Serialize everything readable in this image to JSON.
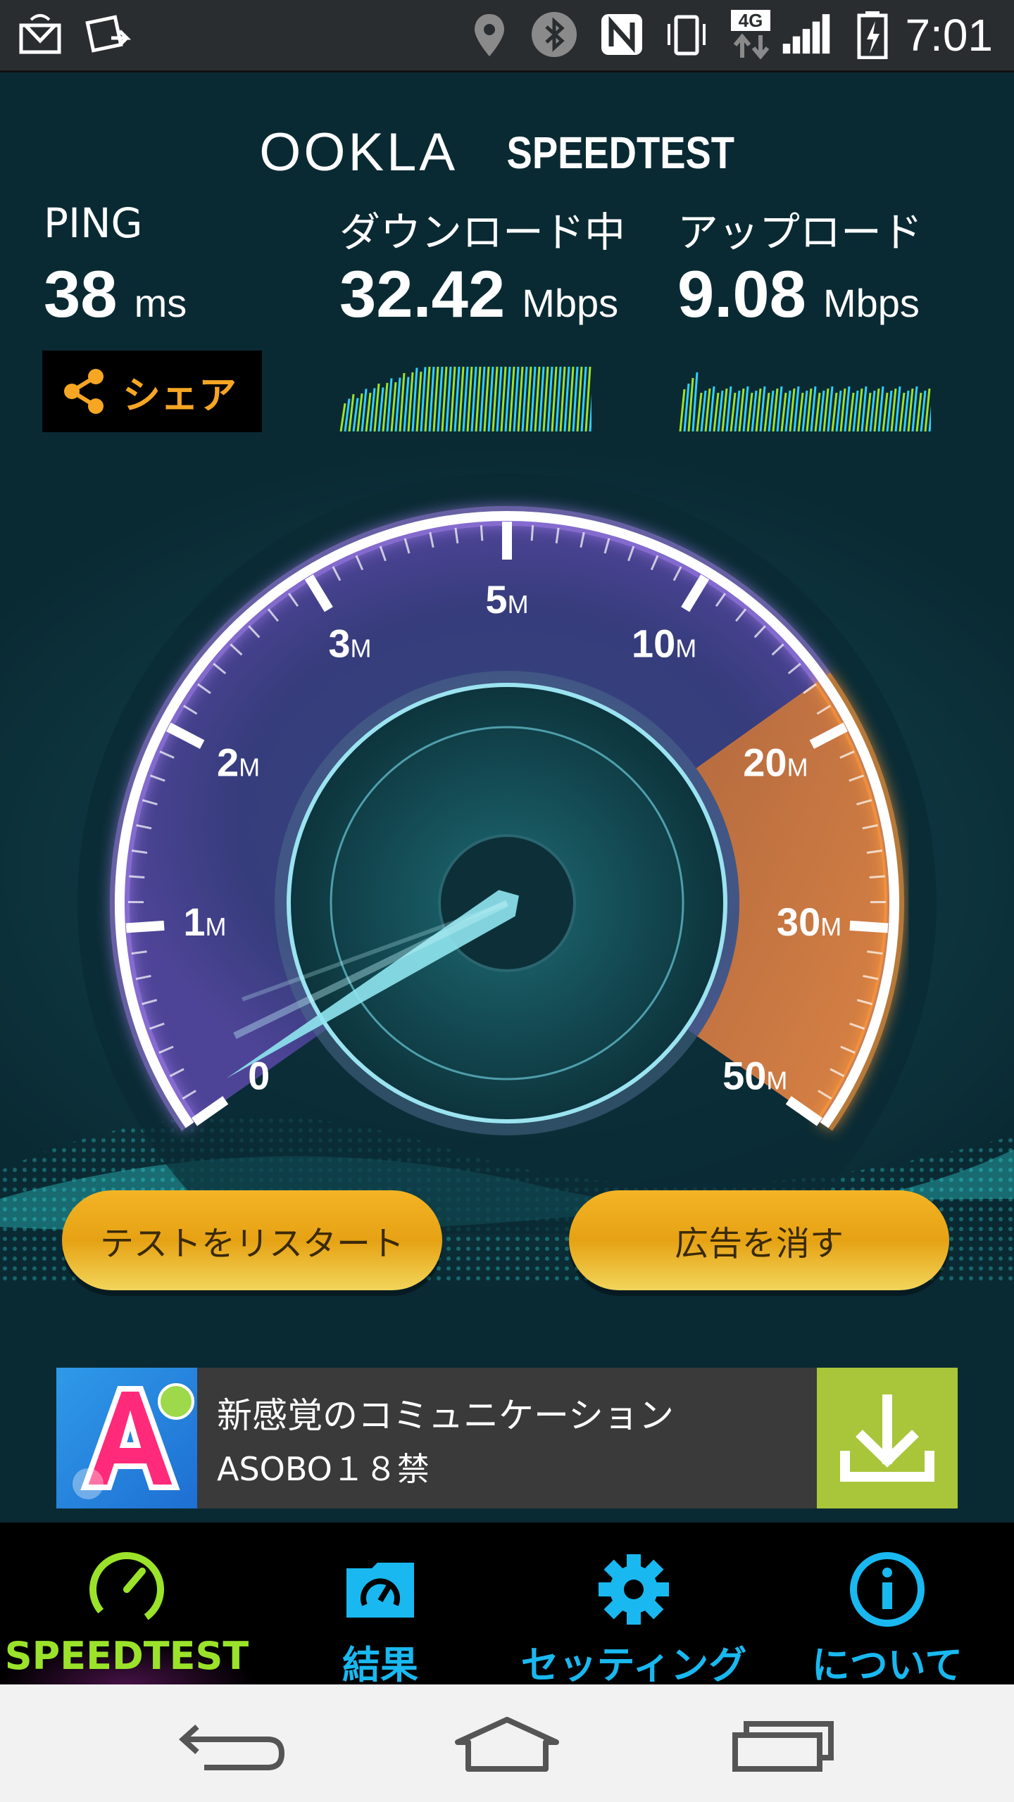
{
  "status_bar": {
    "time": "7:01",
    "network_type": "4G",
    "icons": [
      "screen-share-icon",
      "photo-notification-icon",
      "location-icon",
      "bluetooth-icon",
      "nfc-icon",
      "vibrate-icon",
      "signal-icon",
      "battery-charging-icon"
    ]
  },
  "brand": {
    "ookla": "OOKLA",
    "speedtest": "SPEEDTEST"
  },
  "metrics": {
    "ping": {
      "label": "PING",
      "value": "38",
      "unit": "ms"
    },
    "download": {
      "label": "ダウンロード中",
      "value": "32.42",
      "unit": "Mbps"
    },
    "upload": {
      "label": "アップロード",
      "value": "9.08",
      "unit": "Mbps"
    }
  },
  "share_label": "シェア",
  "gauge": {
    "ticks": [
      {
        "num": "0",
        "suffix": ""
      },
      {
        "num": "1",
        "suffix": "M"
      },
      {
        "num": "2",
        "suffix": "M"
      },
      {
        "num": "3",
        "suffix": "M"
      },
      {
        "num": "5",
        "suffix": "M"
      },
      {
        "num": "10",
        "suffix": "M"
      },
      {
        "num": "20",
        "suffix": "M"
      },
      {
        "num": "30",
        "suffix": "M"
      },
      {
        "num": "50",
        "suffix": "M"
      }
    ],
    "current_speed_mbps": 32.42,
    "colors": {
      "arc_low": "#7e5cc8",
      "arc_high": "#f08a2a",
      "needle": "#8fe6f0"
    }
  },
  "buttons": {
    "restart": "テストをリスタート",
    "remove_ads": "広告を消す"
  },
  "ad": {
    "title": "新感覚のコミュニケーション",
    "subtitle": "ASOBO１８禁"
  },
  "tabs": [
    {
      "label": "SPEEDTEST",
      "color": "#9be32a",
      "icon": "speedometer-icon"
    },
    {
      "label": "結果",
      "color": "#19b8f0",
      "icon": "results-folder-icon"
    },
    {
      "label": "セッティング",
      "color": "#19b8f0",
      "icon": "gear-icon"
    },
    {
      "label": "について",
      "color": "#19b8f0",
      "icon": "info-icon"
    }
  ]
}
